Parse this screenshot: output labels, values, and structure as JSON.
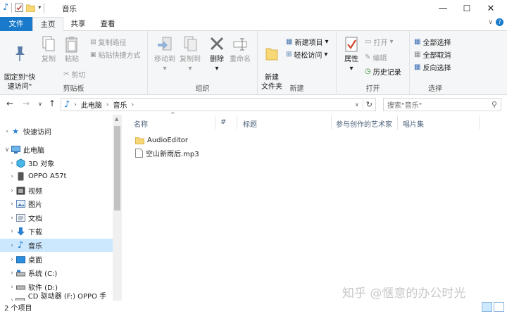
{
  "window": {
    "title": "音乐",
    "minimize": "—",
    "maximize": "☐",
    "close": "✕"
  },
  "tabs": [
    "文件",
    "主页",
    "共享",
    "查看"
  ],
  "ribbon": {
    "clipboard": {
      "label": "剪贴板",
      "pin": "固定到\"快\n速访问\"",
      "copy": "复制",
      "paste": "粘贴",
      "copy_path": "复制路径",
      "paste_shortcut": "粘贴快捷方式",
      "cut": "剪切"
    },
    "organize": {
      "label": "组织",
      "move_to": "移动到",
      "copy_to": "复制到",
      "delete": "删除",
      "rename": "重命名"
    },
    "new": {
      "label": "新建",
      "new_folder": "新建\n文件夹",
      "new_item": "新建项目",
      "easy_access": "轻松访问"
    },
    "open": {
      "label": "打开",
      "properties": "属性",
      "open": "打开",
      "edit": "编辑",
      "history": "历史记录"
    },
    "select": {
      "label": "选择",
      "select_all": "全部选择",
      "select_none": "全部取消",
      "invert": "反向选择"
    }
  },
  "address": {
    "crumbs": [
      "此电脑",
      "音乐"
    ],
    "search_placeholder": "搜索\"音乐\""
  },
  "nav": [
    {
      "label": "快速访问",
      "icon": "star-icon",
      "level": 0
    },
    {
      "label": "此电脑",
      "icon": "computer-icon",
      "level": 0,
      "expanded": true
    },
    {
      "label": "3D 对象",
      "icon": "cube-icon",
      "level": 1
    },
    {
      "label": "OPPO A57t",
      "icon": "phone-icon",
      "level": 1
    },
    {
      "label": "视频",
      "icon": "video-icon",
      "level": 1
    },
    {
      "label": "图片",
      "icon": "picture-icon",
      "level": 1
    },
    {
      "label": "文档",
      "icon": "document-icon",
      "level": 1
    },
    {
      "label": "下载",
      "icon": "download-icon",
      "level": 1
    },
    {
      "label": "音乐",
      "icon": "music-icon",
      "level": 1,
      "selected": true
    },
    {
      "label": "桌面",
      "icon": "desktop-icon",
      "level": 1
    },
    {
      "label": "系统 (C:)",
      "icon": "drive-icon",
      "level": 1
    },
    {
      "label": "软件 (D:)",
      "icon": "drive-icon",
      "level": 1
    },
    {
      "label": "CD 驱动器 (F:) OPPO 手机",
      "icon": "cd-icon",
      "level": 1
    }
  ],
  "columns": [
    "名称",
    "#",
    "标题",
    "参与创作的艺术家",
    "唱片集"
  ],
  "files": [
    {
      "name": "AudioEditor",
      "type": "folder"
    },
    {
      "name": "空山新雨后.mp3",
      "type": "file"
    }
  ],
  "status": {
    "count": "2 个项目"
  },
  "watermark": "知乎 @惬意的办公时光",
  "colors": {
    "accent": "#1979ca",
    "selected": "#cce8ff"
  }
}
